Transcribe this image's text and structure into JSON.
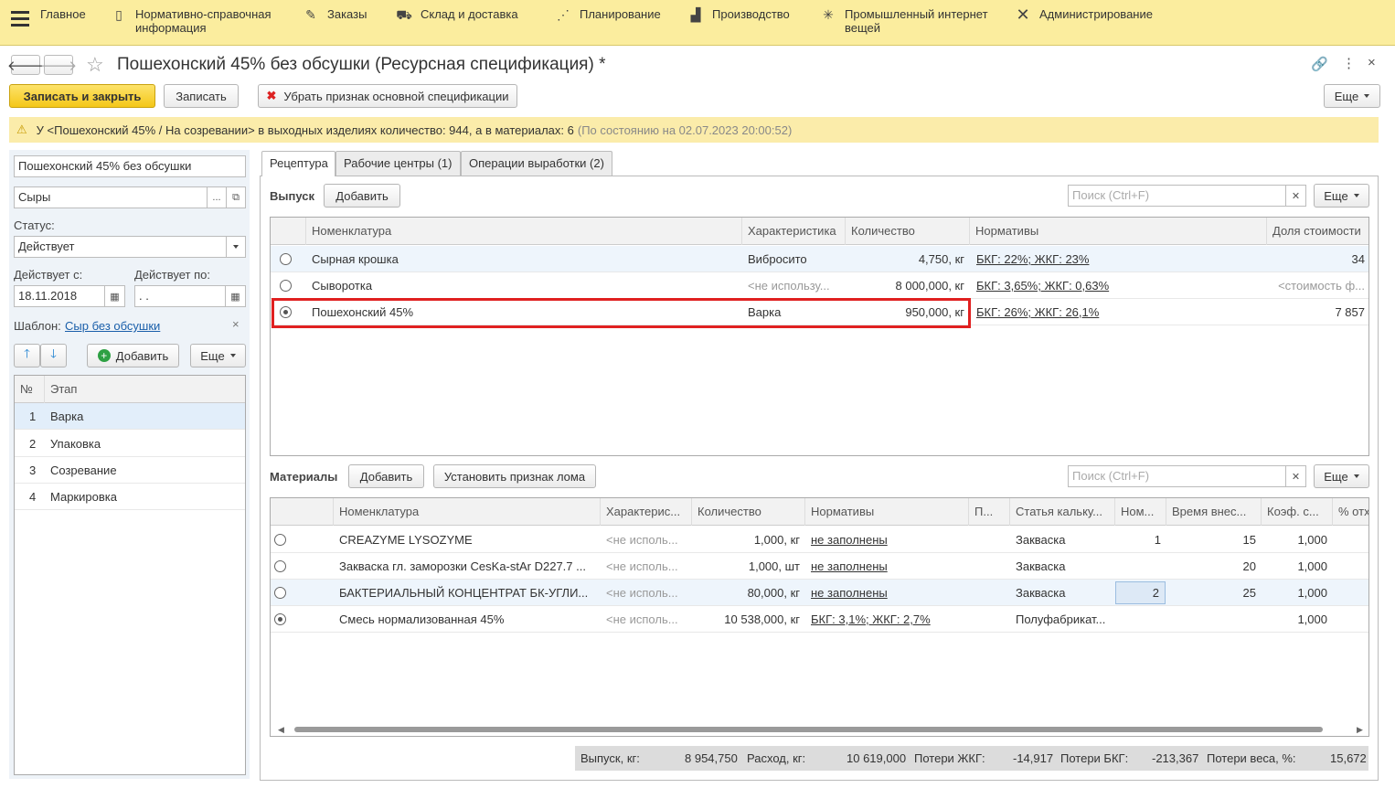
{
  "topnav": {
    "items": [
      {
        "label": "Главное",
        "icon": "home-icon"
      },
      {
        "label": "Нормативно-справочная\nинформация",
        "icon": "book-icon"
      },
      {
        "label": "Заказы",
        "icon": "orders-icon"
      },
      {
        "label": "Склад и доставка",
        "icon": "truck-icon"
      },
      {
        "label": "Планирование",
        "icon": "planning-icon"
      },
      {
        "label": "Производство",
        "icon": "factory-icon"
      },
      {
        "label": "Промышленный интернет\nвещей",
        "icon": "iot-icon"
      },
      {
        "label": "Администрирование",
        "icon": "tools-icon"
      }
    ]
  },
  "window": {
    "title": "Пошехонский 45% без обсушки (Ресурсная спецификация) *"
  },
  "toolbar": {
    "save_close": "Записать и закрыть",
    "save": "Записать",
    "remove_flag": "Убрать признак основной спецификации",
    "more": "Еще"
  },
  "warning": {
    "text": "У <Пошехонский 45% / На созревании> в выходных изделиях количество: 944, а в материалах: 6",
    "state": "(По состоянию на 02.07.2023 20:00:52)"
  },
  "left": {
    "name": "Пошехонский 45% без обсушки",
    "group": "Сыры",
    "status_label": "Статус:",
    "status": "Действует",
    "from_label": "Действует с:",
    "from": "18.11.2018",
    "to_label": "Действует по:",
    "to": " .  .",
    "template_label": "Шаблон:",
    "template": "Сыр без обсушки",
    "add": "Добавить",
    "more": "Еще",
    "stages_headers": {
      "num": "№",
      "stage": "Этап"
    },
    "stages": [
      {
        "num": "1",
        "name": "Варка"
      },
      {
        "num": "2",
        "name": "Упаковка"
      },
      {
        "num": "3",
        "name": "Созревание"
      },
      {
        "num": "4",
        "name": "Маркировка"
      }
    ]
  },
  "tabs": [
    "Рецептура",
    "Рабочие центры (1)",
    "Операции выработки (2)"
  ],
  "output": {
    "title": "Выпуск",
    "add": "Добавить",
    "search_placeholder": "Поиск (Ctrl+F)",
    "more": "Еще",
    "headers": [
      "Номенклатура",
      "Характеристика",
      "Количество",
      "Нормативы",
      "Доля стоимости"
    ],
    "rows": [
      {
        "name": "Сырная крошка",
        "char": "Вибросито",
        "qty": "4,750, кг",
        "norm": "БКГ: 22%; ЖКГ: 23%",
        "share": "34",
        "selected": false
      },
      {
        "name": "Сыворотка",
        "char": "<не использу...",
        "qty": "8 000,000, кг",
        "norm": "БКГ: 3,65%; ЖКГ: 0,63%",
        "share": "<стоимость ф...",
        "selected": false
      },
      {
        "name": "Пошехонский 45%",
        "char": "Варка",
        "qty": "950,000, кг",
        "norm": "БКГ: 26%; ЖКГ: 26,1%",
        "share": "7 857",
        "selected": true
      }
    ]
  },
  "materials": {
    "title": "Материалы",
    "add": "Добавить",
    "scrap": "Установить признак лома",
    "search_placeholder": "Поиск (Ctrl+F)",
    "more": "Еще",
    "headers": [
      "Номенклатура",
      "Характерис...",
      "Количество",
      "Нормативы",
      "П...",
      "Статья кальку...",
      "Ном...",
      "Время внес...",
      "Коэф. с...",
      "% отх"
    ],
    "rows": [
      {
        "name": "CREAZYME LYSOZYME",
        "char": "<не исполь...",
        "qty": "1,000, кг",
        "norm": "не заполнены",
        "p": "",
        "article": "Закваска",
        "nom": "1",
        "time": "15",
        "coef": "1,000",
        "selected": false
      },
      {
        "name": "Закваска гл. заморозки CesKa-stAr D227.7 ...",
        "char": "<не исполь...",
        "qty": "1,000, шт",
        "norm": "не заполнены",
        "p": "",
        "article": "Закваска",
        "nom": "",
        "time": "20",
        "coef": "1,000",
        "selected": false
      },
      {
        "name": "БАКТЕРИАЛЬНЫЙ КОНЦЕНТРАТ БК-УГЛИ...",
        "char": "<не исполь...",
        "qty": "80,000, кг",
        "norm": "не заполнены",
        "p": "",
        "article": "Закваска",
        "nom": "2",
        "time": "25",
        "coef": "1,000",
        "selected": false
      },
      {
        "name": "Смесь нормализованная 45%",
        "char": "<не исполь...",
        "qty": "10 538,000, кг",
        "norm": "БКГ: 3,1%; ЖКГ: 2,7%",
        "p": "",
        "article": "Полуфабрикат...",
        "nom": "",
        "time": "",
        "coef": "1,000",
        "selected": true
      }
    ]
  },
  "footer": {
    "out_label": "Выпуск, кг:",
    "out": "8 954,750",
    "use_label": "Расход, кг:",
    "use": "10 619,000",
    "zhkg_label": "Потери ЖКГ:",
    "zhkg": "-14,917",
    "bkg_label": "Потери БКГ:",
    "bkg": "-213,367",
    "weight_label": "Потери веса, %:",
    "weight": "15,672"
  }
}
